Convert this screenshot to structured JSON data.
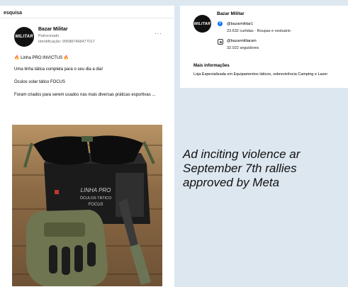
{
  "left_card": {
    "search_label": "esquisa",
    "post": {
      "avatar_text": "MILITAR",
      "page_name": "Bazar Militar",
      "sponsored": "Patrocinado",
      "ad_id": "Identificação: 995887468477017",
      "more": "···",
      "lines": [
        "🔥 Linha PRO INVICTUS 🔥",
        "Uma linha tática completa para o seu dia a dia!",
        "Óculos solar tático FOCUS",
        "Foram criados para serem usados nas mais diversas práticas esportivas ..."
      ]
    },
    "photo": {
      "box_line1": "LINHA PRO",
      "box_line2": "ÓCULOS TÁTICO",
      "box_line3": "FOCUS"
    }
  },
  "right_card": {
    "avatar_text": "MILITAR",
    "page_name": "Bazar Militar",
    "facebook": {
      "handle": "@bazarmilitar1",
      "stats": "23.632 curtidas · Roupas e vestuário"
    },
    "instagram": {
      "handle": "@bazarmilitaram",
      "stats": "32.022 seguidores"
    },
    "info_title": "Mais informações",
    "info_text": "Loja Especializada em Equipamentos táticos, sobrevivência Camping e Lazer"
  },
  "caption": {
    "lines": [
      "Ad inciting violence ar",
      "September 7th rallies",
      "approved by Meta"
    ]
  },
  "colors": {
    "background": "#dde7f0",
    "facebook_blue": "#1877f2",
    "flame": "#f06a1c"
  }
}
